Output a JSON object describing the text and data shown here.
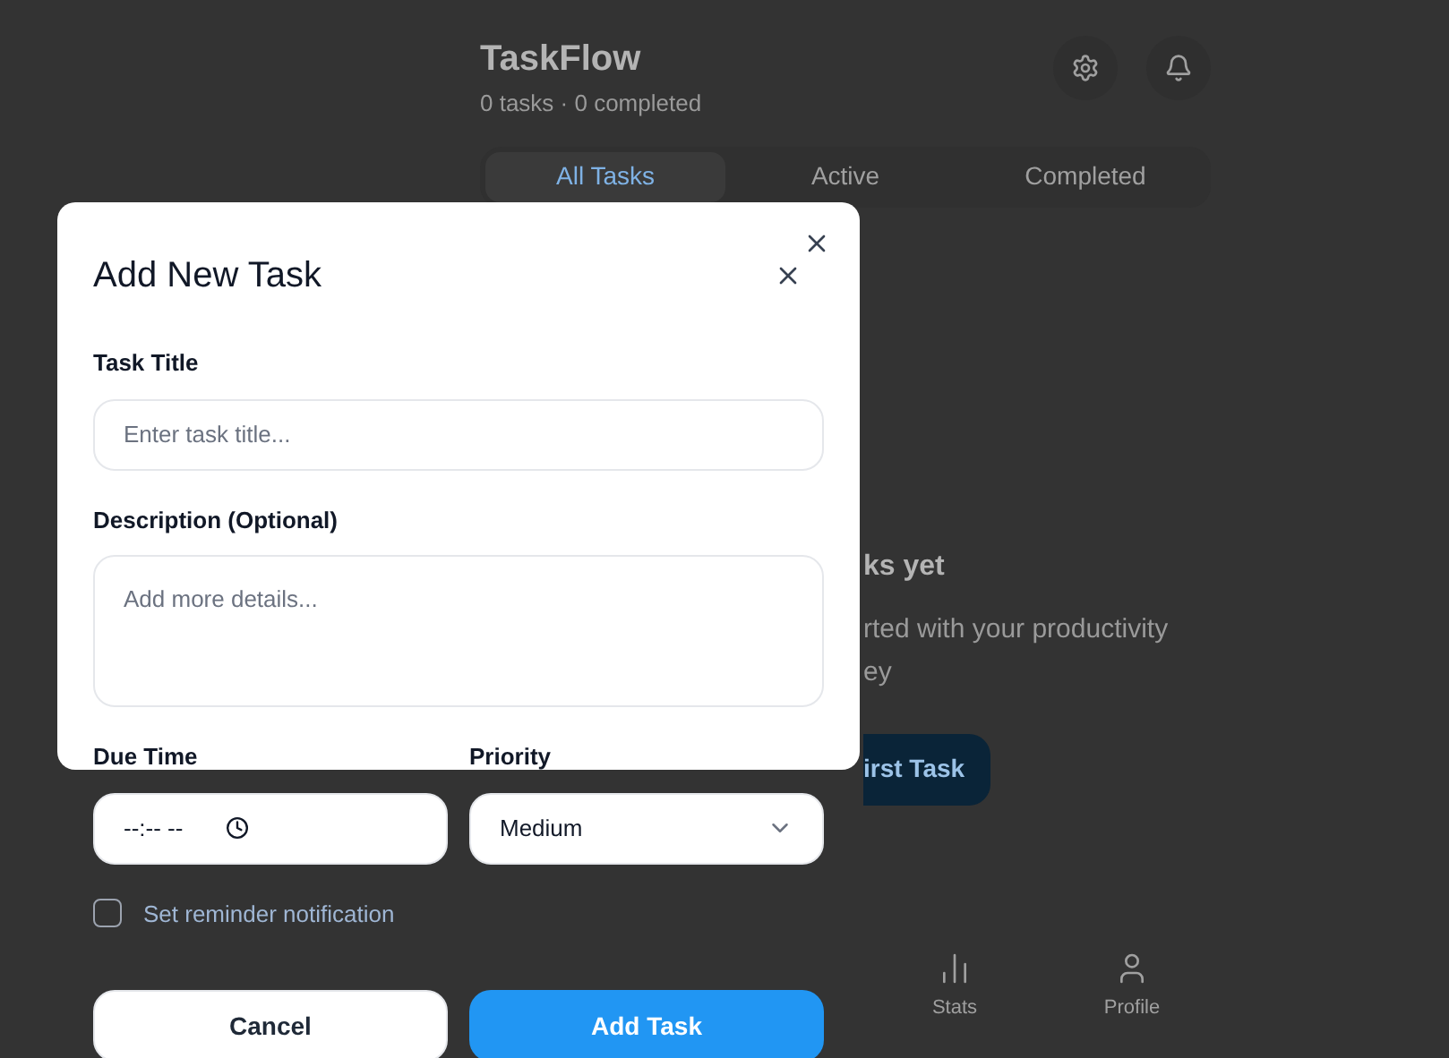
{
  "app": {
    "title": "TaskFlow",
    "subtitle": "0 tasks · 0 completed",
    "tabs": [
      {
        "label": "All Tasks",
        "selected": true
      },
      {
        "label": "Active",
        "selected": false
      },
      {
        "label": "Completed",
        "selected": false
      }
    ],
    "empty_state": {
      "heading": "ks yet",
      "message_lines": [
        "rted with your productivity",
        "ey"
      ],
      "button": "irst Task"
    },
    "bottom_nav": [
      {
        "label": "Stats",
        "kind": "stats"
      },
      {
        "label": "Profile",
        "kind": "profile"
      }
    ]
  },
  "dialog": {
    "title": "Add New Task",
    "task_title": {
      "label": "Task Title",
      "placeholder": "Enter task title..."
    },
    "description": {
      "label": "Description (Optional)",
      "placeholder": "Add more details..."
    },
    "due_time": {
      "label": "Due Time",
      "value": "--:-- --"
    },
    "priority": {
      "label": "Priority",
      "value": "Medium"
    },
    "reminder": {
      "label": "Set reminder notification",
      "checked": false
    },
    "buttons": [
      {
        "label": "Cancel",
        "kind": "secondary"
      },
      {
        "label": "Add Task",
        "kind": "primary"
      }
    ]
  }
}
